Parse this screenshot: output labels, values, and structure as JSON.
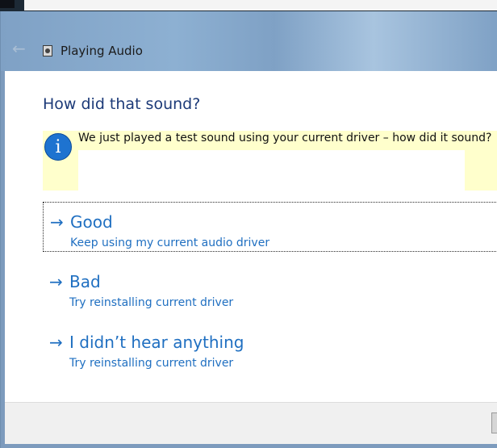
{
  "window": {
    "title": "Playing Audio",
    "icons": {
      "back": "back-arrow-icon",
      "app": "speaker-icon"
    }
  },
  "page": {
    "heading": "How did that sound?",
    "info": {
      "icon": "info-icon",
      "glyph": "i",
      "text": "We just played a test sound using your current driver – how did it sound?"
    },
    "options": [
      {
        "arrow": "→",
        "label": "Good",
        "sub": "Keep using my current audio driver"
      },
      {
        "arrow": "→",
        "label": "Bad",
        "sub": "Try reinstalling current driver"
      },
      {
        "arrow": "→",
        "label": "I didn’t hear anything",
        "sub": "Try reinstalling current driver"
      }
    ]
  },
  "colors": {
    "link": "#1f6fc1",
    "heading": "#1c3a78",
    "info_bg": "#ffffcc",
    "info_icon": "#1e73d0"
  }
}
